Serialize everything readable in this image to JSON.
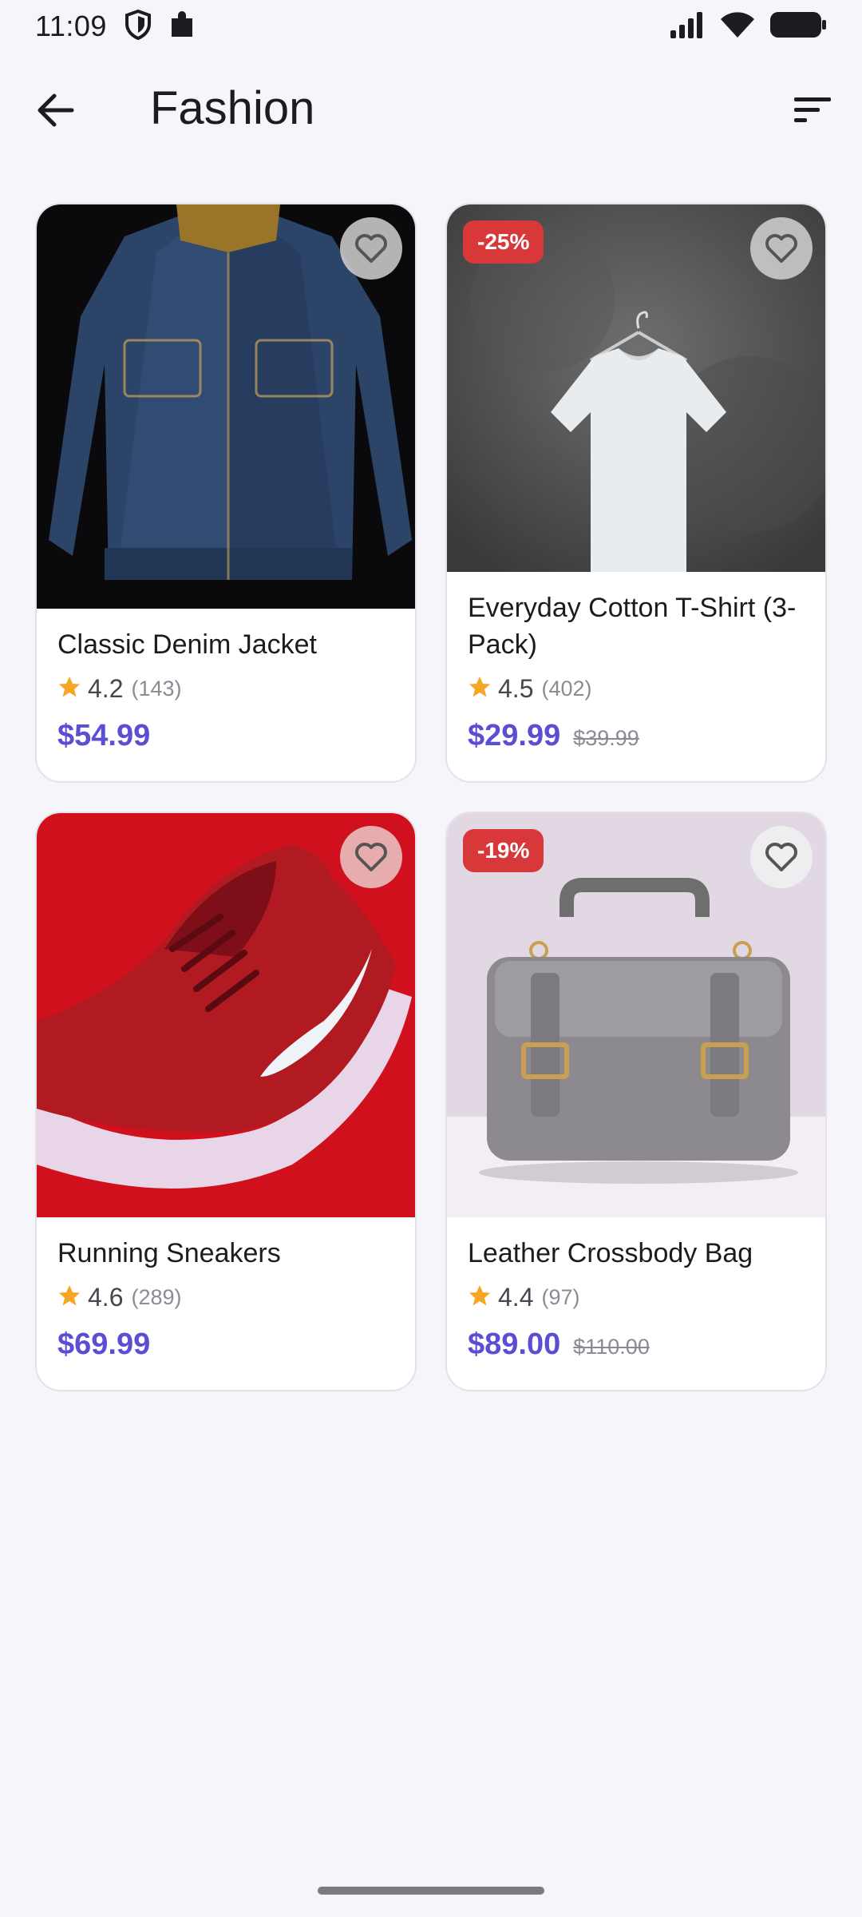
{
  "status_bar": {
    "time": "11:09",
    "left_icons": [
      "shield-icon",
      "puzzle-icon"
    ],
    "right_icons": [
      "signal-icon",
      "wifi-icon",
      "battery-icon"
    ]
  },
  "app_bar": {
    "title": "Fashion",
    "back_icon": "arrow-back-icon",
    "sort_icon": "sort-icon"
  },
  "products": [
    {
      "name": "Classic Denim Jacket",
      "rating": "4.2",
      "reviews": "(143)",
      "price": "$54.99",
      "old_price": "",
      "discount": "",
      "image": "denim-jacket"
    },
    {
      "name": "Everyday Cotton T-Shirt (3-Pack)",
      "rating": "4.5",
      "reviews": "(402)",
      "price": "$29.99",
      "old_price": "$39.99",
      "discount": "-25%",
      "image": "white-t-shirt"
    },
    {
      "name": "Running Sneakers",
      "rating": "4.6",
      "reviews": "(289)",
      "price": "$69.99",
      "old_price": "",
      "discount": "",
      "image": "red-sneaker"
    },
    {
      "name": "Leather Crossbody Bag",
      "rating": "4.4",
      "reviews": "(97)",
      "price": "$89.00",
      "old_price": "$110.00",
      "discount": "-19%",
      "image": "grey-bag"
    }
  ],
  "colors": {
    "accent": "#5b4ed3",
    "star": "#f5a623",
    "badge": "#d8383a",
    "background": "#f6f5fa"
  }
}
